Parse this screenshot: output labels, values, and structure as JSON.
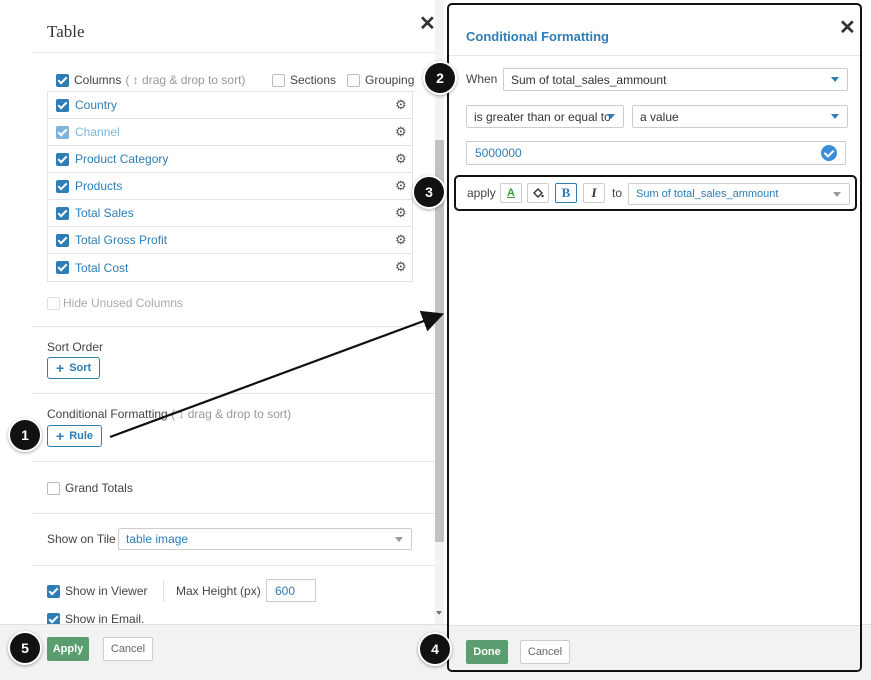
{
  "left_panel": {
    "title": "Table",
    "columns_label": "Columns",
    "columns_hint": "( ↕ drag & drop to sort)",
    "sections_label": "Sections",
    "grouping_label": "Grouping",
    "columns": [
      {
        "name": "Country",
        "checked": true
      },
      {
        "name": "Channel",
        "checked": true
      },
      {
        "name": "Product Category",
        "checked": true
      },
      {
        "name": "Products",
        "checked": true
      },
      {
        "name": "Total Sales",
        "checked": true
      },
      {
        "name": "Total Gross Profit",
        "checked": true
      },
      {
        "name": "Total Cost",
        "checked": true
      }
    ],
    "hide_unused_label": "Hide Unused Columns",
    "sort_order_label": "Sort Order",
    "sort_button": "Sort",
    "cond_format_label": "Conditional Formatting",
    "cond_format_hint": "( ↕ drag & drop to sort)",
    "rule_button": "Rule",
    "grand_totals_label": "Grand Totals",
    "show_on_tile_label": "Show on Tile",
    "show_on_tile_value": "table image",
    "show_in_viewer_label": "Show in Viewer",
    "max_height_label": "Max Height (px)",
    "max_height_value": "600",
    "show_in_email_label": "Show in Email."
  },
  "left_footer": {
    "apply": "Apply",
    "cancel": "Cancel"
  },
  "right_panel": {
    "title": "Conditional Formatting",
    "when_label": "When",
    "when_field": "Sum of total_sales_ammount",
    "operator": "is greater than or equal to",
    "compare_type": "a value",
    "value": "5000000",
    "apply_label": "apply",
    "to_label": "to",
    "target_field": "Sum of total_sales_ammount",
    "bold_glyph": "B",
    "italic_glyph": "I",
    "textcolor_glyph": "A"
  },
  "right_footer": {
    "done": "Done",
    "cancel": "Cancel"
  },
  "callouts": [
    "1",
    "2",
    "3",
    "4",
    "5"
  ],
  "icons": {
    "close": "close-icon",
    "gear": "gear-icon",
    "plus": "plus-icon",
    "fill": "paint-bucket-icon",
    "check": "checkmark-icon"
  },
  "colors": {
    "accent": "#2e7db5",
    "green_button": "#5a9e6f",
    "callout": "#111111"
  }
}
